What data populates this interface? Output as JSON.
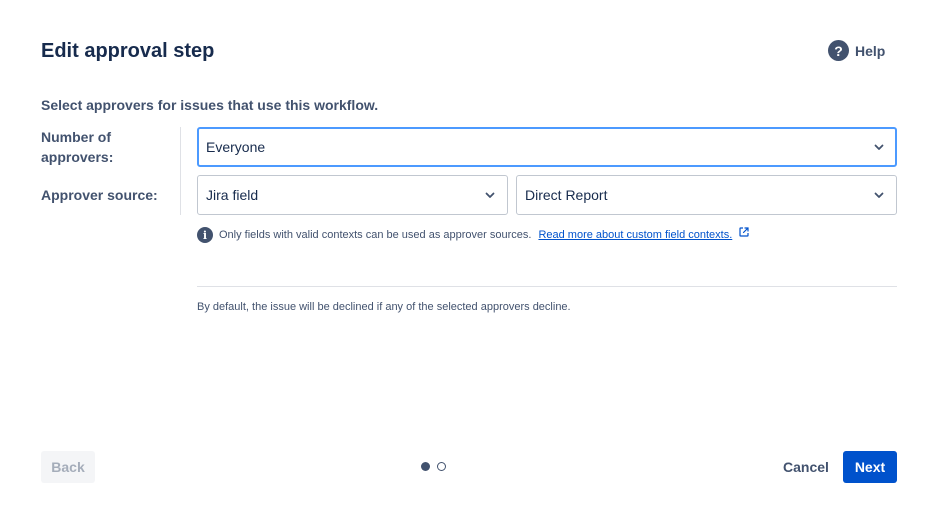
{
  "dialog": {
    "title": "Edit approval step",
    "help_label": "Help",
    "subtitle": "Select approvers for issues that use this workflow."
  },
  "form": {
    "number_label": "Number of approvers:",
    "number_value": "Everyone",
    "source_label": "Approver source:",
    "source_type_value": "Jira field",
    "source_field_value": "Direct Report",
    "info_text": "Only fields with valid contexts can be used as approver sources.",
    "info_link": "Read more about custom field contexts.",
    "note": "By default, the issue will be declined if any of the selected approvers decline."
  },
  "footer": {
    "back_label": "Back",
    "cancel_label": "Cancel",
    "next_label": "Next",
    "steps_total": 2,
    "steps_current": 1
  },
  "icons": {
    "help": "question-circle-icon",
    "info": "info-circle-icon",
    "external": "external-link-icon",
    "chevron": "chevron-down-icon"
  },
  "colors": {
    "primary": "#0052cc",
    "focus_border": "#4c9aff",
    "text_primary": "#172b4d",
    "text_secondary": "#42526e",
    "disabled_text": "#a5adba"
  }
}
